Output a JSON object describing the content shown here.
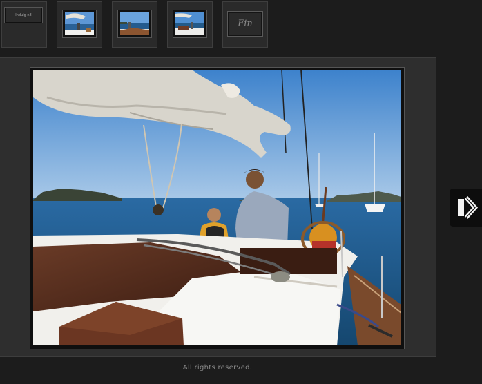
{
  "thumbnails": {
    "intro_label": "Indulg n8",
    "fin_label": "Fin"
  },
  "main_photo": {
    "alt": "Sailing yacht deck with two crew members at sea"
  },
  "navigation": {
    "next_icon": "chevron-right-icon"
  },
  "footer": {
    "copyright": "All rights reserved."
  },
  "colors": {
    "background": "#1c1c1c",
    "stage": "#2e2e2e",
    "sky": "#4f8fd2",
    "sea": "#1f5a8c"
  }
}
